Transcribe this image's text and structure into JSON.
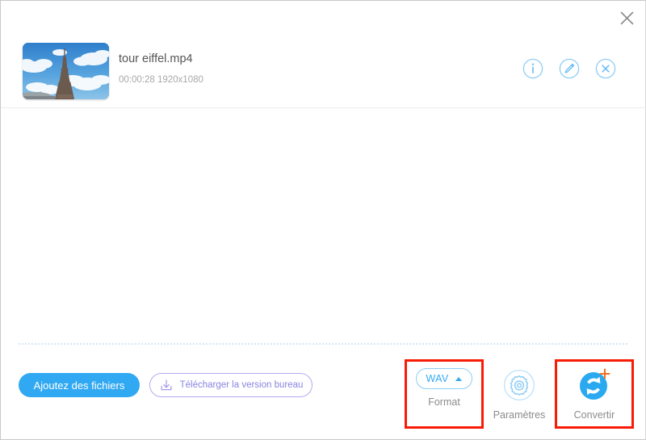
{
  "window": {
    "close_icon": "close-icon"
  },
  "file": {
    "name": "tour eiffel.mp4",
    "specs": "00:00:28  1920x1080",
    "thumbnail_alt": "eiffel-tower-thumbnail",
    "actions": [
      {
        "name": "info-icon",
        "label": "i"
      },
      {
        "name": "edit-icon",
        "label": ""
      },
      {
        "name": "remove-icon",
        "label": ""
      }
    ]
  },
  "toolbar": {
    "add_files_label": "Ajoutez des fichiers",
    "download_desktop_label": "Télécharger la version bureau",
    "download_icon": "download-icon",
    "format": {
      "value": "WAV",
      "label": "Format",
      "caret_icon": "chevron-up-icon",
      "highlighted": true
    },
    "settings": {
      "label": "Paramètres",
      "icon": "gear-icon",
      "highlighted": false
    },
    "convert": {
      "label": "Convertir",
      "icon": "convert-refresh-icon",
      "sparkle_icon": "sparkle-icon",
      "highlighted": true
    }
  },
  "colors": {
    "accent_blue": "#31a9f2",
    "light_blue_border": "#8ecdf5",
    "purple": "#8b84e0",
    "highlight_red": "#f81b06",
    "sparkle_orange": "#f5701e",
    "text_gray": "#8b8b8b"
  }
}
